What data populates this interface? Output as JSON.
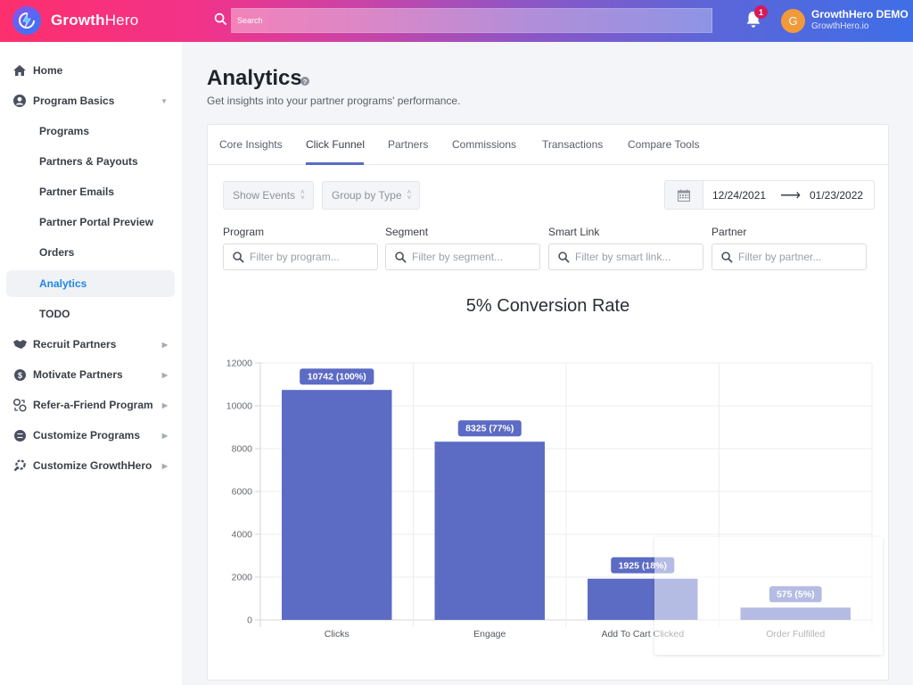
{
  "header": {
    "brand_bold": "Growth",
    "brand_light": "Hero",
    "search_placeholder": "Search",
    "notification_count": "1",
    "avatar_initial": "G",
    "user_name": "GrowthHero DEMO",
    "user_domain": "GrowthHero.io"
  },
  "sidebar": {
    "items": [
      {
        "label": "Home",
        "icon": "home-icon"
      },
      {
        "label": "Program Basics",
        "icon": "user-circle-icon",
        "expanded": true
      },
      {
        "label": "Programs"
      },
      {
        "label": "Partners & Payouts"
      },
      {
        "label": "Partner Emails"
      },
      {
        "label": "Partner Portal Preview"
      },
      {
        "label": "Orders"
      },
      {
        "label": "Analytics",
        "active": true
      },
      {
        "label": "TODO"
      },
      {
        "label": "Recruit Partners",
        "icon": "handshake-icon"
      },
      {
        "label": "Motivate Partners",
        "icon": "dollar-coin-icon"
      },
      {
        "label": "Refer-a-Friend Program",
        "icon": "refer-coins-icon"
      },
      {
        "label": "Customize Programs",
        "icon": "sliders-icon"
      },
      {
        "label": "Customize GrowthHero",
        "icon": "wrench-gear-icon"
      }
    ]
  },
  "page": {
    "title": "Analytics",
    "subtitle": "Get insights into your partner programs' performance."
  },
  "tabs": [
    {
      "label": "Core Insights"
    },
    {
      "label": "Click Funnel",
      "active": true
    },
    {
      "label": "Partners"
    },
    {
      "label": "Commissions"
    },
    {
      "label": "Transactions"
    },
    {
      "label": "Compare Tools"
    }
  ],
  "controls": {
    "show_events": "Show Events",
    "group_by": "Group by Type",
    "date_start": "12/24/2021",
    "date_arrow": "⟶",
    "date_end": "01/23/2022"
  },
  "filters": [
    {
      "label": "Program",
      "placeholder": "Filter by program..."
    },
    {
      "label": "Segment",
      "placeholder": "Filter by segment..."
    },
    {
      "label": "Smart Link",
      "placeholder": "Filter by smart link..."
    },
    {
      "label": "Partner",
      "placeholder": "Filter by partner..."
    }
  ],
  "colors": {
    "accent": "#5b6ac7",
    "bar": "#5c6bc4",
    "active_link": "#1f86e8"
  },
  "chart_data": {
    "type": "bar",
    "title": "5% Conversion Rate",
    "categories": [
      "Clicks",
      "Engage",
      "Add To Cart Clicked",
      "Order Fulfilled"
    ],
    "values": [
      10742,
      8325,
      1925,
      575
    ],
    "data_labels": [
      "10742 (100%)",
      "8325 (77%)",
      "1925 (18%)",
      "575 (5%)"
    ],
    "ylim": [
      0,
      12000
    ],
    "yticks": [
      0,
      2000,
      4000,
      6000,
      8000,
      10000,
      12000
    ],
    "xlabel": "",
    "ylabel": "",
    "grid": true,
    "legend": "none"
  }
}
